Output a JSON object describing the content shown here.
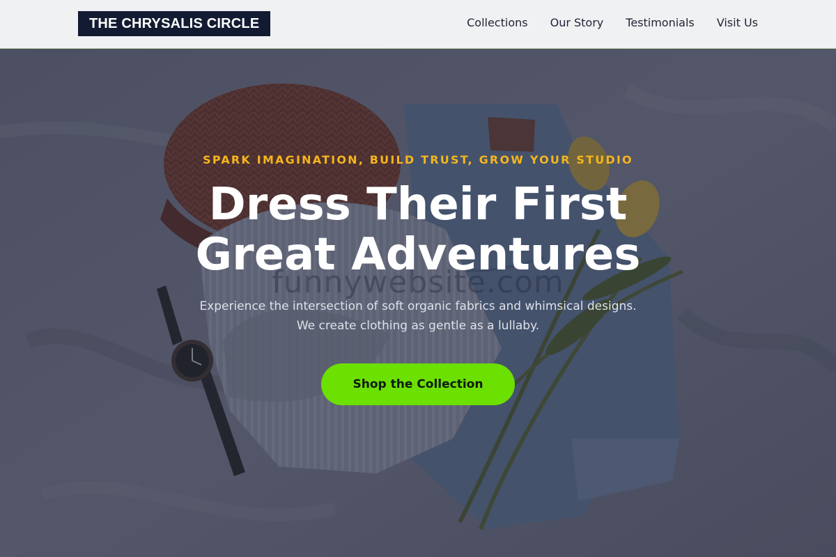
{
  "brand": {
    "name": "THE CHRYSALIS CIRCLE"
  },
  "nav": {
    "items": [
      "Collections",
      "Our Story",
      "Testimonials",
      "Visit Us"
    ]
  },
  "hero": {
    "eyebrow": "SPARK IMAGINATION, BUILD TRUST, GROW YOUR STUDIO",
    "title_line1": "Dress Their First",
    "title_line2": "Great Adventures",
    "subtitle_line1": "Experience the intersection of soft organic fabrics and whimsical designs.",
    "subtitle_line2": "We create clothing as gentle as a lullaby.",
    "cta_label": "Shop the Collection",
    "watermark": "funnywebsite.com"
  },
  "colors": {
    "header_bg": "#f0f1f3",
    "logo_bg": "#121b31",
    "accent_eyebrow": "#f6b61c",
    "cta_bg": "#6ce000",
    "overlay": "#282c3e"
  }
}
